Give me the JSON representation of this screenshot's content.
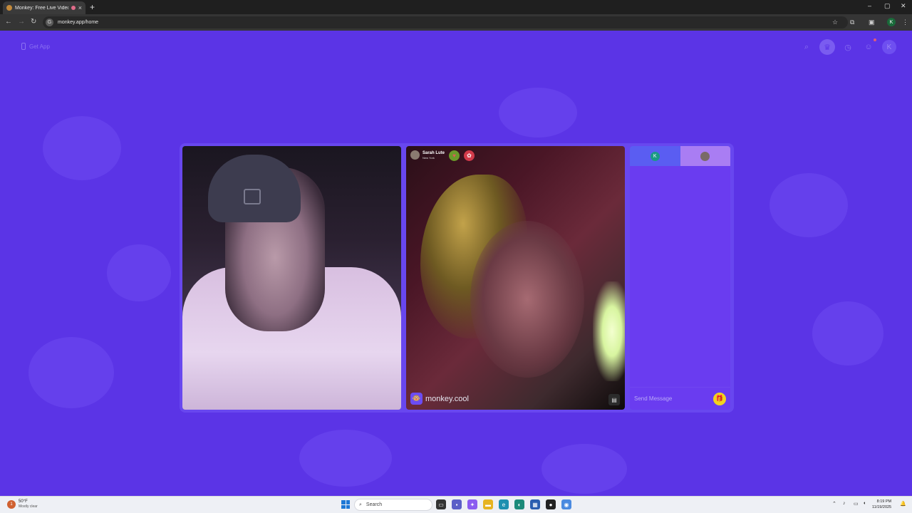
{
  "browser": {
    "tab_title": "Monkey: Free Live Video Ch",
    "tab_close": "×",
    "new_tab": "+",
    "url": "monkey.app/home",
    "site_icon_letter": "G",
    "profile_letter": "K",
    "window_controls": [
      "–",
      "▢",
      "✕"
    ]
  },
  "header": {
    "get_app_label": "Get App",
    "avatar_letter": "K"
  },
  "remote_user": {
    "name": "Sarah Lute",
    "location": "New York"
  },
  "watermark": {
    "text": "monkey.cool"
  },
  "chat": {
    "self_avatar_letter": "K",
    "message_placeholder": "Send Message"
  },
  "taskbar": {
    "weather_temp": "50°F",
    "weather_desc": "Mostly clear",
    "weather_badge": "1",
    "search_placeholder": "Search",
    "time": "8:19 PM",
    "date": "11/19/2025"
  },
  "colors": {
    "page_background": "#5b34e6",
    "accent": "#6a3cf0",
    "gift_button": "#f3d21e"
  }
}
